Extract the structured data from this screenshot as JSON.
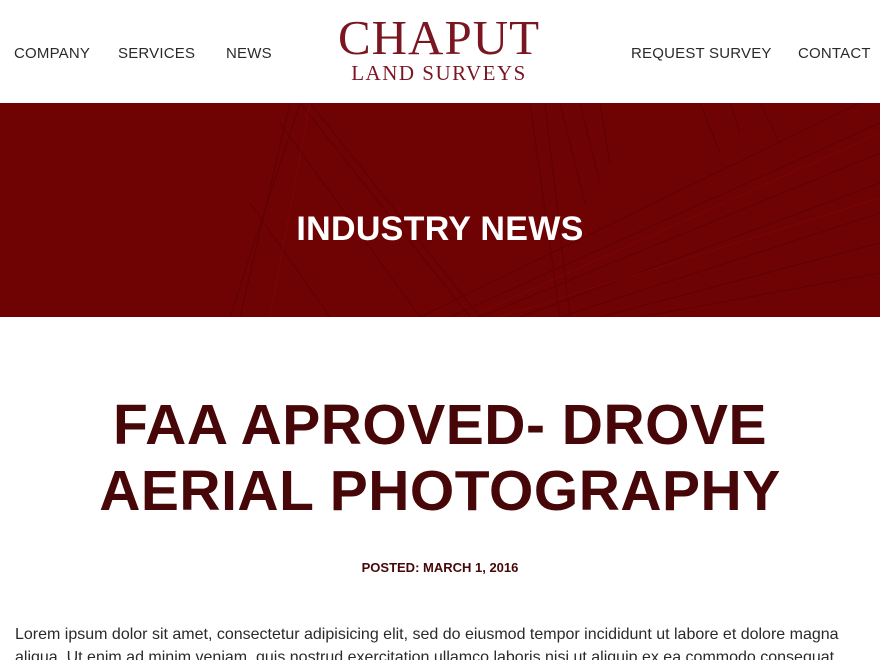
{
  "nav": {
    "company": "COMPANY",
    "services": "SERVICES",
    "news": "NEWS",
    "request_survey": "REQUEST SURVEY",
    "contact": "CONTACT"
  },
  "logo": {
    "main": "CHAPUT",
    "sub": "LAND SURVEYS"
  },
  "banner": {
    "title": "INDUSTRY NEWS"
  },
  "article": {
    "title": "FAA APROVED- DROVE AERIAL PHOTOGRAPHY",
    "posted": "POSTED: MARCH 1, 2016",
    "body": "Lorem ipsum dolor sit amet, consectetur adipisicing elit, sed do eiusmod tempor incididunt ut labore et dolore magna aliqua. Ut enim ad minim veniam, quis nostrud exercitation ullamco laboris nisi ut aliquip ex ea commodo consequat."
  },
  "colors": {
    "brand": "#7a1622",
    "banner": "#6f0203",
    "heading": "#470708"
  }
}
